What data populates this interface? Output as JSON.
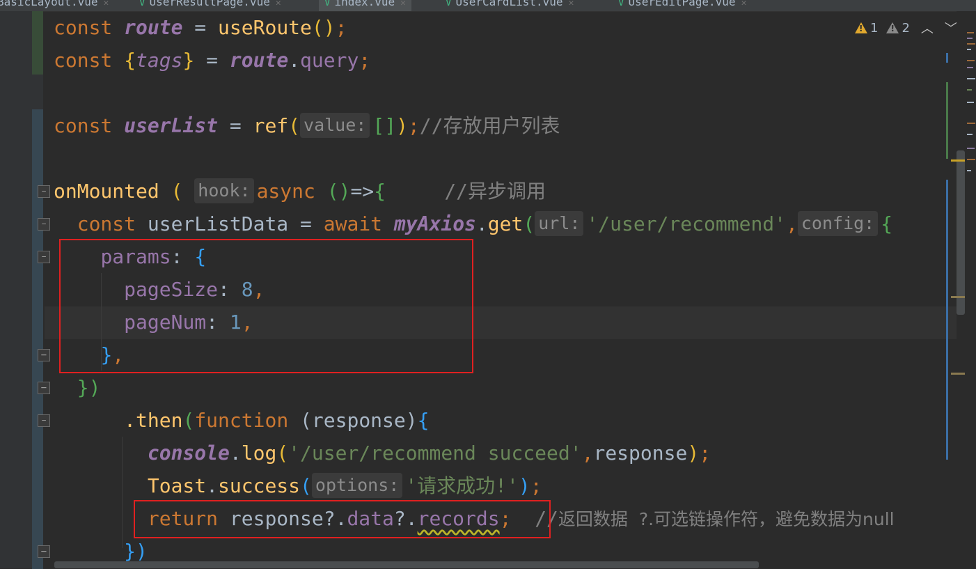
{
  "tabs": [
    {
      "label": "BasicLayout.vue",
      "active": false
    },
    {
      "label": "UserResultPage.vue",
      "active": false
    },
    {
      "label": "index.vue",
      "active": true
    },
    {
      "label": "UserCardList.vue",
      "active": false
    },
    {
      "label": "UserEditPage.vue",
      "active": false
    }
  ],
  "inspection": {
    "warnings": "1",
    "weak_warnings": "2",
    "up_icon": "chevron-up-icon",
    "down_icon": "chevron-down-icon"
  },
  "code": {
    "line1": {
      "kw": "const",
      "var": "route",
      "op": " = ",
      "fn": "useRoute",
      "p1": "(",
      "p2": ")",
      "semi": ";"
    },
    "line2": {
      "kw": "const",
      "open": "{",
      "var": "tags",
      "close": "}",
      "op": " = ",
      "obj": "route",
      "dot": ".",
      "prop": "query",
      "semi": ";"
    },
    "line4": {
      "kw": "const",
      "var": "userList",
      "op": " = ",
      "fn": "ref",
      "p1": "(",
      "hint": "value:",
      "arr": "[]",
      "p2": ")",
      "semi": ";",
      "comment": "//存放用户列表"
    },
    "line6": {
      "fn": "onMounted",
      "p1": "(",
      "hint": "hook:",
      "kw": "async",
      "args": "()",
      "arrow": "=>",
      "brace": "{",
      "comment": "//异步调用"
    },
    "line7": {
      "kw": "const",
      "name": "userListData",
      "op": " = ",
      "await": "await",
      "obj": "myAxios",
      "dot": ".",
      "fn": "get",
      "p1": "(",
      "hint_url": "url:",
      "url": "'/user/recommend'",
      "comma": ",",
      "hint_config": "config:",
      "brace": "{"
    },
    "line8": {
      "key": "params",
      "colon": ": ",
      "brace": "{"
    },
    "line9": {
      "key": "pageSize",
      "colon": ": ",
      "value": "8",
      "comma": ","
    },
    "line10": {
      "key": "pageNum",
      "colon": ": ",
      "value": "1",
      "comma": ","
    },
    "line11": {
      "brace": "}",
      "comma": ","
    },
    "line12": {
      "close": "})"
    },
    "line13": {
      "method": ".then",
      "p1": "(",
      "kw": "function",
      "args": "(response)",
      "brace": "{"
    },
    "line14": {
      "obj": "console",
      "dot": ".",
      "fn": "log",
      "p1": "(",
      "str": "'/user/recommend succeed'",
      "comma": ",",
      "arg": "response",
      "p2": ")",
      "semi": ";"
    },
    "line15": {
      "obj": "Toast",
      "dot": ".",
      "fn": "success",
      "p1": "(",
      "hint": "options:",
      "str": "'请求成功!'",
      "p2": ")",
      "semi": ";"
    },
    "line16": {
      "kw": "return",
      "base": "response",
      "opt1": "?.",
      "p1": "data",
      "opt2": "?.",
      "p2": "records",
      "semi": ";",
      "comment_slash": "//",
      "comment": "返回数据  ?.可选链操作符，避免数据为null"
    },
    "line17": {
      "close": "})"
    }
  },
  "colors": {
    "keyword": "#cc7832",
    "property": "#9876aa",
    "string": "#6a8759",
    "number": "#6897bb",
    "comment": "#808080",
    "annotation_box": "#e02020"
  }
}
